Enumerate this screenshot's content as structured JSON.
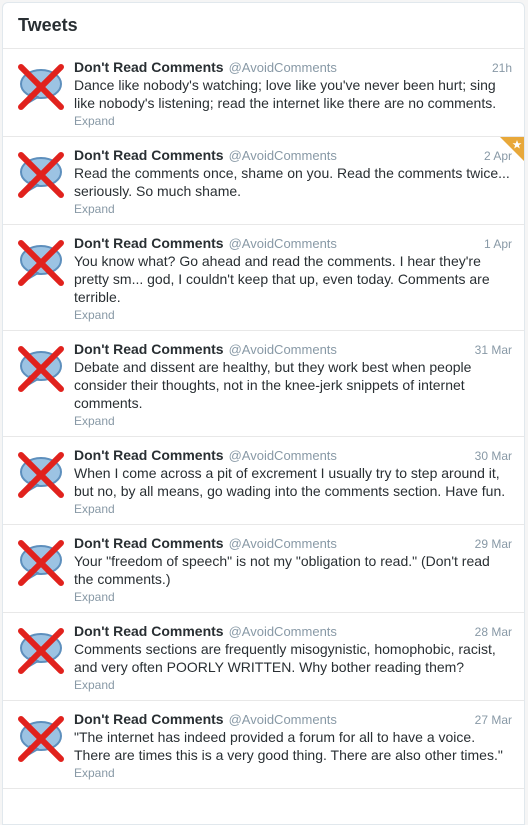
{
  "header": {
    "title": "Tweets"
  },
  "colors": {
    "accent": "#e8a83a",
    "cross": "#e1221d",
    "bubble": "#8ab6d9"
  },
  "tweets": [
    {
      "fullname": "Don't Read Comments",
      "username": "@AvoidComments",
      "time": "21h",
      "text": "Dance like nobody's watching; love like you've never been hurt; sing like nobody's listening; read the internet like there are no comments.",
      "expand": "Expand",
      "favorited": false
    },
    {
      "fullname": "Don't Read Comments",
      "username": "@AvoidComments",
      "time": "2 Apr",
      "text": "Read the comments once, shame on you. Read the comments twice... seriously. So much shame.",
      "expand": "Expand",
      "favorited": true
    },
    {
      "fullname": "Don't Read Comments",
      "username": "@AvoidComments",
      "time": "1 Apr",
      "text": "You know what? Go ahead and read the comments. I hear they're pretty sm... god, I couldn't keep that up, even today. Comments are terrible.",
      "expand": "Expand",
      "favorited": false
    },
    {
      "fullname": "Don't Read Comments",
      "username": "@AvoidComments",
      "time": "31 Mar",
      "text": "Debate and dissent are healthy, but they work best when people consider their thoughts, not in the knee-jerk snippets of internet comments.",
      "expand": "Expand",
      "favorited": false
    },
    {
      "fullname": "Don't Read Comments",
      "username": "@AvoidComments",
      "time": "30 Mar",
      "text": "When I come across a pit of excrement I usually try to step around it, but no, by all means, go wading into the comments section. Have fun.",
      "expand": "Expand",
      "favorited": false
    },
    {
      "fullname": "Don't Read Comments",
      "username": "@AvoidComments",
      "time": "29 Mar",
      "text": "Your \"freedom of speech\" is not my \"obligation to read.\" (Don't read the comments.)",
      "expand": "Expand",
      "favorited": false
    },
    {
      "fullname": "Don't Read Comments",
      "username": "@AvoidComments",
      "time": "28 Mar",
      "text": "Comments sections are frequently misogynistic, homophobic, racist, and very often POORLY WRITTEN. Why bother reading them?",
      "expand": "Expand",
      "favorited": false
    },
    {
      "fullname": "Don't Read Comments",
      "username": "@AvoidComments",
      "time": "27 Mar",
      "text": "\"The internet has indeed provided a forum for all to have a voice. There are times this is a very good thing. There are also other times.\"",
      "expand": "Expand",
      "favorited": false
    }
  ]
}
